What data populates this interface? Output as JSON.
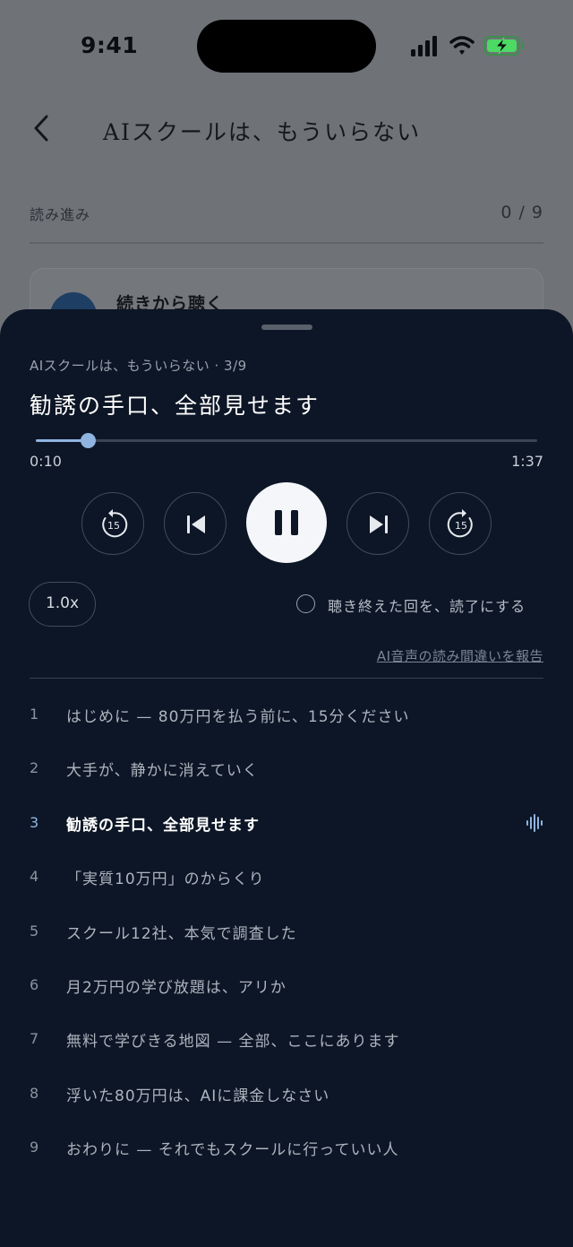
{
  "status_bar": {
    "time": "9:41"
  },
  "background_page": {
    "title": "AIスクールは、もういらない",
    "progress_label": "読み進み",
    "progress_count": "0 / 9",
    "resume_label": "続きから聴く"
  },
  "player": {
    "meta": "AIスクールは、もういらない · 3/9",
    "title": "勧誘の手口、全部見せます",
    "position": "0:10",
    "duration": "1:37",
    "progress_fraction": 0.103,
    "speed": "1.0x",
    "finish_toggle_label": "聴き終えた回を、読了にする",
    "report_link": "AI音声の読み間違いを報告",
    "skip_back_seconds": "15",
    "skip_forward_seconds": "15"
  },
  "chapters": [
    {
      "num": "1",
      "title": "はじめに — 80万円を払う前に、15分ください"
    },
    {
      "num": "2",
      "title": "大手が、静かに消えていく"
    },
    {
      "num": "3",
      "title": "勧誘の手口、全部見せます",
      "active": true
    },
    {
      "num": "4",
      "title": "「実質10万円」のからくり"
    },
    {
      "num": "5",
      "title": "スクール12社、本気で調査した"
    },
    {
      "num": "6",
      "title": "月2万円の学び放題は、アリか"
    },
    {
      "num": "7",
      "title": "無料で学びきる地図 — 全部、ここにあります"
    },
    {
      "num": "8",
      "title": "浮いた80万円は、AIに課金しなさい"
    },
    {
      "num": "9",
      "title": "おわりに — それでもスクールに行っていい人"
    }
  ],
  "colors": {
    "sheet_bg": "#0d1626",
    "accent": "#8fb4e0",
    "battery_charging": "#4cd964"
  },
  "icons": {
    "back": "chevron-left-icon",
    "skip_back": "rewind-15-icon",
    "previous": "skip-previous-icon",
    "pause": "pause-icon",
    "next": "skip-next-icon",
    "skip_forward": "forward-15-icon",
    "now_playing": "audio-wave-icon"
  }
}
